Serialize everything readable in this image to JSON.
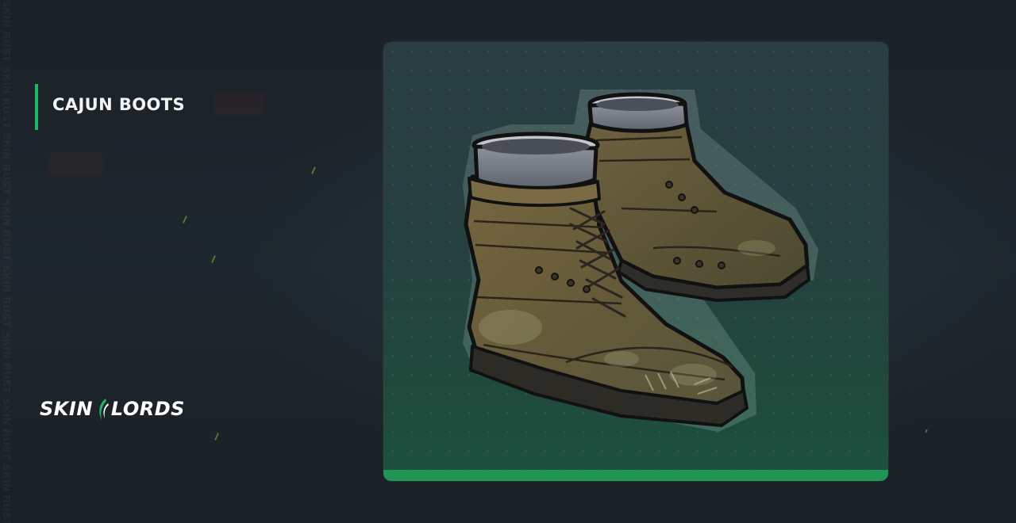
{
  "item": {
    "name": "CAJUN BOOTS",
    "image_icon": "boots-icon"
  },
  "brand": {
    "logo_part1": "SKIN",
    "logo_part2": "LORDS",
    "logo_mark_icon": "claw-mark-icon"
  },
  "watermark": {
    "text": "SKIN RUST SKIN RUST SKIN RUST SKIN RUST SKIN RUST SKIN RUST SKIN RUST SKIN RUST"
  },
  "colors": {
    "accent": "#22b56a",
    "card_bar": "#1f9654",
    "background": "#1c2329",
    "title": "#f2f4f4"
  }
}
